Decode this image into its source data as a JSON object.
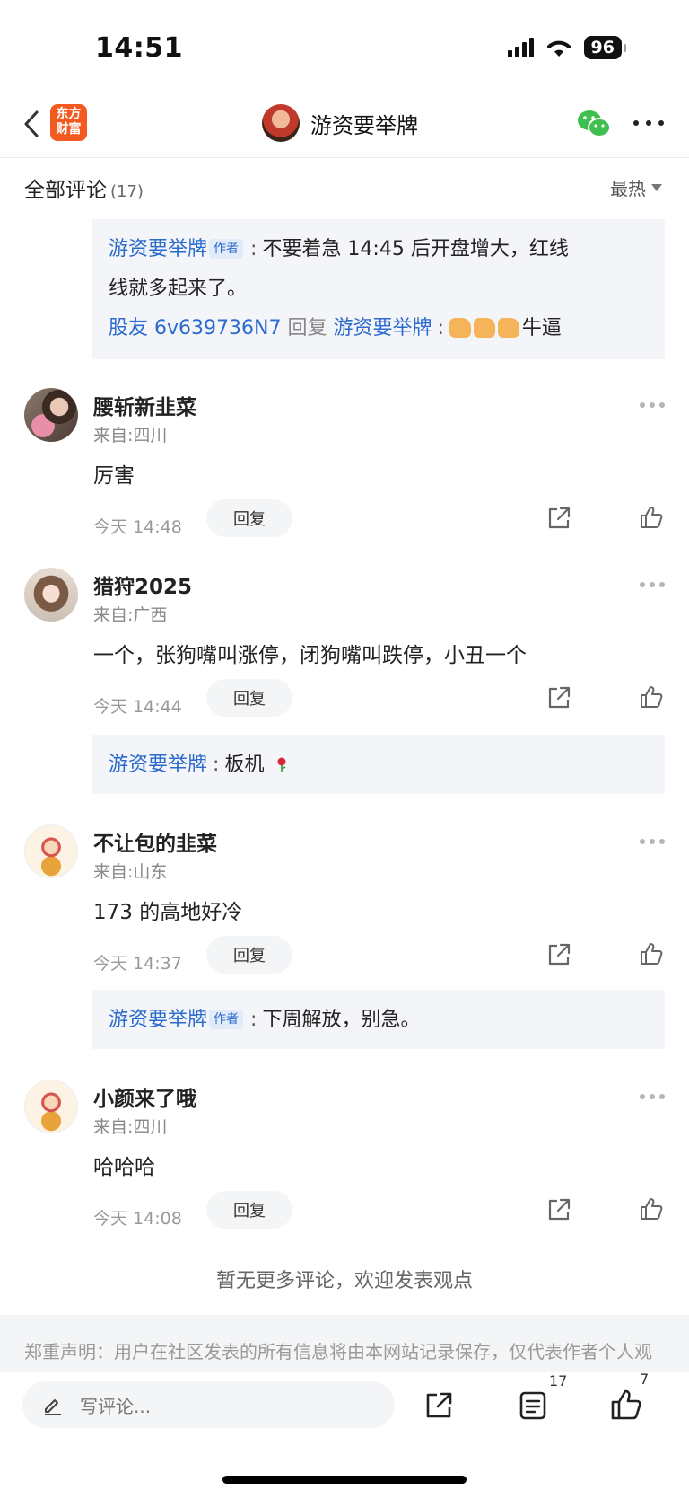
{
  "status_bar": {
    "time": "14:51",
    "battery": "96"
  },
  "nav": {
    "logo_text": "东方财富",
    "title": "游资要举牌"
  },
  "comments_header": {
    "title": "全部评论",
    "count": "(17)",
    "sort": "最热"
  },
  "top_reply_box": {
    "reply_1": {
      "user": "游资要举牌",
      "tag": "作者",
      "text_line1": "不要着急 14:45 后开盘增大，红线",
      "text_line2": "线就多起来了。"
    },
    "reply_2": {
      "user": "股友 6v639736N7",
      "action": "回复",
      "target": "游资要举牌",
      "text": "牛逼"
    }
  },
  "comments": [
    {
      "name": "腰斩新韭菜",
      "location": "来自:四川",
      "text": "厉害",
      "time": "今天 14:48",
      "reply_label": "回复"
    },
    {
      "name": "猎狩2025",
      "location": "来自:广西",
      "text": "一个，张狗嘴叫涨停，闭狗嘴叫跌停，小丑一个",
      "time": "今天 14:44",
      "reply_label": "回复",
      "reply": {
        "user": "游资要举牌",
        "text": "板机"
      }
    },
    {
      "name": "不让包的韭菜",
      "location": "来自:山东",
      "text": "173 的高地好冷",
      "time": "今天 14:37",
      "reply_label": "回复",
      "reply": {
        "user": "游资要举牌",
        "tag": "作者",
        "text": "下周解放，别急。"
      }
    },
    {
      "name": "小颜来了哦",
      "location": "来自:四川",
      "text": "哈哈哈",
      "time": "今天 14:08",
      "reply_label": "回复"
    }
  ],
  "no_more_text": "暂无更多评论，欢迎发表观点",
  "disclaimer": "郑重声明：用户在社区发表的所有信息将由本网站记录保存，仅代表作者个人观点，与本网站立场无关，不对您构成任何投资建议，据此操作风险自担。",
  "bottom_bar": {
    "input_placeholder": "写评论...",
    "comment_count": "17",
    "like_count": "7"
  },
  "colors": {
    "accent_blue": "#2b6bce",
    "brand_orange": "#f35a20",
    "reply_bg": "#f4f5f9"
  }
}
